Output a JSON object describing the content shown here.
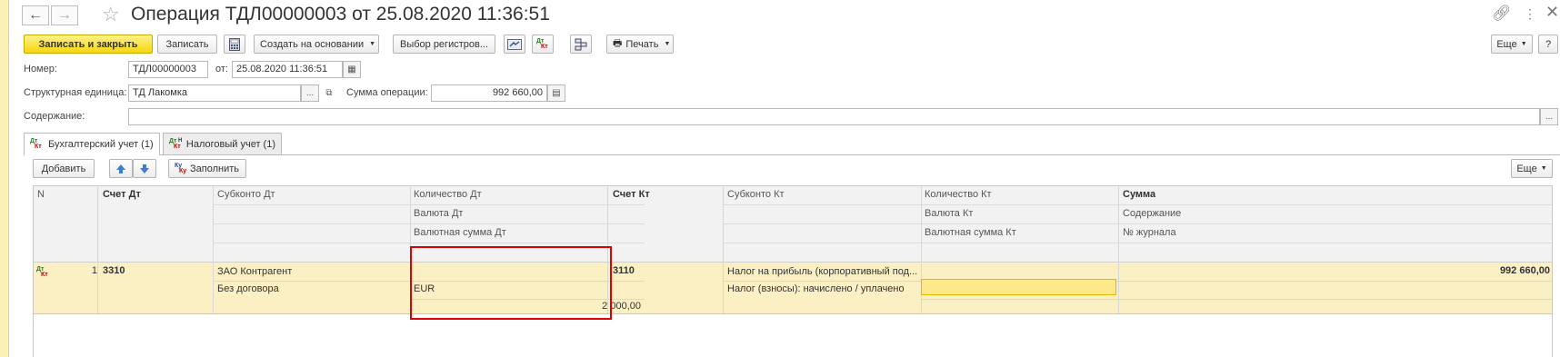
{
  "window": {
    "title": "Операция ТДЛ00000003 от 25.08.2020 11:36:51",
    "nav_back": "←",
    "nav_forward": "→"
  },
  "toolbar": {
    "save_close": "Записать и закрыть",
    "save": "Записать",
    "create_based": "Создать на основании",
    "register_select": "Выбор регистров...",
    "print": "Печать",
    "more": "Еще"
  },
  "form": {
    "number_label": "Номер:",
    "number_value": "ТДЛ00000003",
    "date_label": "от:",
    "date_value": "25.08.2020 11:36:51",
    "unit_label": "Структурная единица:",
    "unit_value": "ТД Лакомка",
    "unit_ellipsis": "...",
    "sum_label": "Сумма операции:",
    "sum_value": "992 660,00",
    "content_label": "Содержание:",
    "content_value": "",
    "content_ellipsis": "..."
  },
  "tabs": [
    {
      "label": "Бухгалтерский учет (1)",
      "icon": "dt-kt-icon"
    },
    {
      "label": "Налоговый учет (1)",
      "icon": "dt-kt-tax-icon"
    }
  ],
  "icon_text": {
    "dt": "Дт",
    "kt": "Кт",
    "h": "Н",
    "ku": "Ку"
  },
  "table_toolbar": {
    "add": "Добавить",
    "fill": "Заполнить",
    "more": "Еще"
  },
  "table": {
    "headers": {
      "n": "N",
      "account_dt": "Счет Дт",
      "subconto_dt": "Субконто Дт",
      "qty_dt": "Количество Дт",
      "currency_dt": "Валюта Дт",
      "cur_sum_dt": "Валютная сумма Дт",
      "account_kt": "Счет Кт",
      "subconto_kt": "Субконто Кт",
      "qty_kt": "Количество Кт",
      "currency_kt": "Валюта Кт",
      "cur_sum_kt": "Валютная сумма Кт",
      "sum": "Сумма",
      "content": "Содержание",
      "journal": "№ журнала"
    },
    "row": {
      "n": "1",
      "account_dt": "3310",
      "subconto_dt_1": "ЗАО Контрагент",
      "subconto_dt_2": "Без договора",
      "currency_dt": "EUR",
      "cur_sum_dt": "2 000,00",
      "account_kt": "3110",
      "subconto_kt_1": "Налог на прибыль (корпоративный под...",
      "subconto_kt_2": "Налог (взносы): начислено / уплачено",
      "sum": "992 660,00"
    }
  }
}
